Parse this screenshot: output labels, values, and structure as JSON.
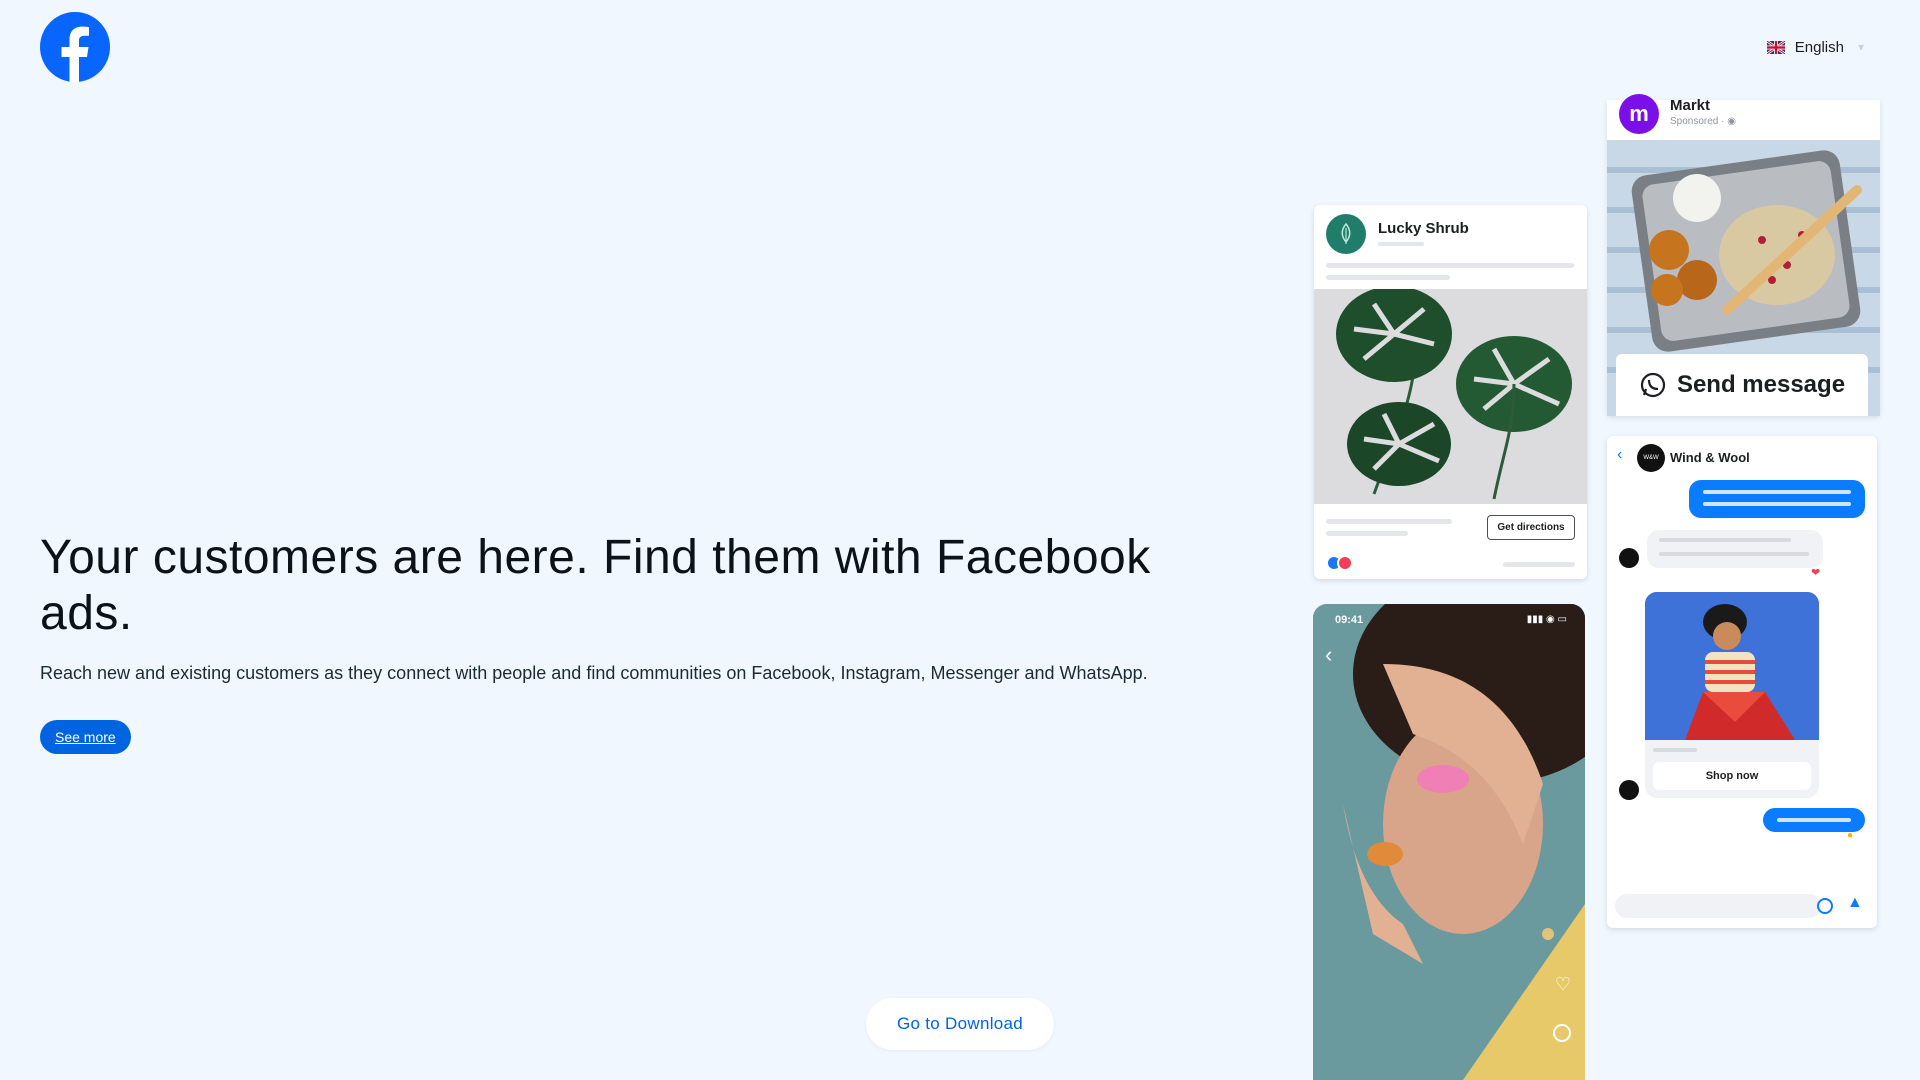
{
  "header": {
    "logo_label": "Facebook",
    "language": {
      "label": "English",
      "flag": "uk-flag-icon"
    }
  },
  "hero": {
    "title": "Your customers are here. Find them with Facebook ads.",
    "subtitle": "Reach new and existing customers as they connect with people and find communities on Facebook, Instagram, Messenger and WhatsApp.",
    "cta_label": "See more"
  },
  "download": {
    "label": "Go to Download"
  },
  "ads": {
    "lucky_shrub": {
      "name": "Lucky Shrub",
      "button": "Get directions"
    },
    "markt": {
      "name": "Markt",
      "sponsored": "Sponsored",
      "button": "Send message"
    },
    "wind_wool": {
      "name": "Wind & Wool",
      "shop_button": "Shop now"
    },
    "reel": {
      "time": "09:41"
    }
  },
  "colors": {
    "background": "#f1f7fe",
    "brand_blue": "#0866ff",
    "button_blue": "#0064e0",
    "messenger_blue": "#0a7cff"
  }
}
